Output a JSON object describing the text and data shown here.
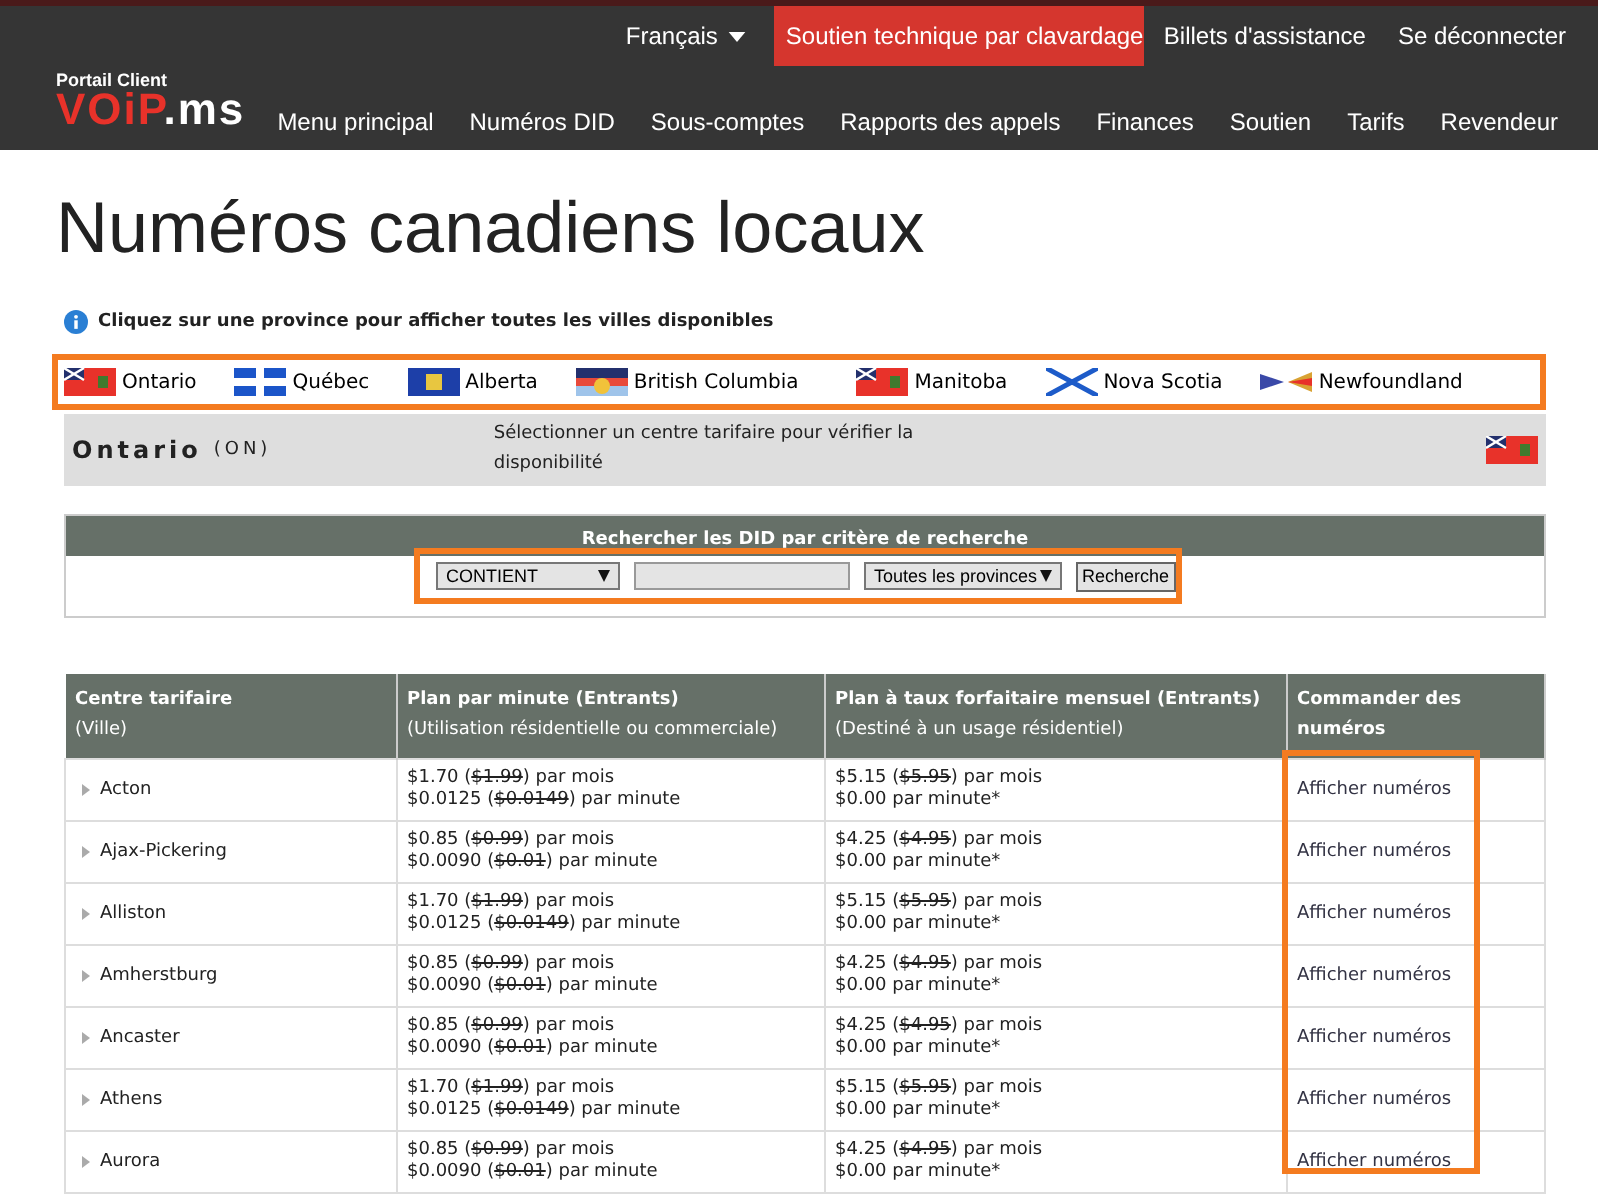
{
  "header": {
    "language": "Français",
    "chat_button": "Soutien technique par clavardage",
    "top_links": [
      "Billets d'assistance",
      "Se déconnecter"
    ],
    "logo_caption": "Portail Client",
    "logo": [
      "VOiP",
      ".ms"
    ],
    "nav": [
      "Menu principal",
      "Numéros DID",
      "Sous-comptes",
      "Rapports des appels",
      "Finances",
      "Soutien",
      "Tarifs",
      "Revendeur"
    ]
  },
  "title": "Numéros canadiens locaux",
  "info": "Cliquez sur une province pour afficher toutes les villes disponibles",
  "provinces": [
    {
      "name": "Ontario"
    },
    {
      "name": "Québec"
    },
    {
      "name": "Alberta"
    },
    {
      "name": "British Columbia"
    },
    {
      "name": "Manitoba"
    },
    {
      "name": "Nova Scotia"
    },
    {
      "name": "Newfoundland"
    }
  ],
  "province_bar": {
    "name": "Ontario",
    "code": "(ON)",
    "hint": "Sélectionner un centre tarifaire pour vérifier la disponibilité"
  },
  "search": {
    "title": "Rechercher les DID par critère de recherche",
    "criteria": "CONTIENT",
    "province": "Toutes les provinces",
    "button": "Recherche"
  },
  "table": {
    "columns": [
      {
        "title": "Centre tarifaire",
        "sub": "(Ville)"
      },
      {
        "title": "Plan par minute (Entrants)",
        "sub": "(Utilisation résidentielle ou commerciale)"
      },
      {
        "title": "Plan à taux forfaitaire mensuel (Entrants)",
        "sub": "(Destiné à un usage résidentiel)"
      },
      {
        "title": "Commander des numéros"
      }
    ],
    "rows": [
      {
        "city": "Acton",
        "per_minute": [
          {
            "pre": "$1.70 (",
            "old": "$1.99",
            "post": ") par mois"
          },
          {
            "pre": "$0.0125 (",
            "old": "$0.0149",
            "post": ") par minute"
          }
        ],
        "flat": [
          {
            "pre": "$5.15 (",
            "old": "$5.95",
            "post": ") par mois"
          },
          {
            "pre": "$0.00 par minute*"
          }
        ],
        "action": "Afficher numéros"
      },
      {
        "city": "Ajax-Pickering",
        "per_minute": [
          {
            "pre": "$0.85 (",
            "old": "$0.99",
            "post": ") par mois"
          },
          {
            "pre": "$0.0090 (",
            "old": "$0.01",
            "post": ") par minute"
          }
        ],
        "flat": [
          {
            "pre": "$4.25 (",
            "old": "$4.95",
            "post": ") par mois"
          },
          {
            "pre": "$0.00 par minute*"
          }
        ],
        "action": "Afficher numéros"
      },
      {
        "city": "Alliston",
        "per_minute": [
          {
            "pre": "$1.70 (",
            "old": "$1.99",
            "post": ") par mois"
          },
          {
            "pre": "$0.0125 (",
            "old": "$0.0149",
            "post": ") par minute"
          }
        ],
        "flat": [
          {
            "pre": "$5.15 (",
            "old": "$5.95",
            "post": ") par mois"
          },
          {
            "pre": "$0.00 par minute*"
          }
        ],
        "action": "Afficher numéros"
      },
      {
        "city": "Amherstburg",
        "per_minute": [
          {
            "pre": "$0.85 (",
            "old": "$0.99",
            "post": ") par mois"
          },
          {
            "pre": "$0.0090 (",
            "old": "$0.01",
            "post": ") par minute"
          }
        ],
        "flat": [
          {
            "pre": "$4.25 (",
            "old": "$4.95",
            "post": ") par mois"
          },
          {
            "pre": "$0.00 par minute*"
          }
        ],
        "action": "Afficher numéros"
      },
      {
        "city": "Ancaster",
        "per_minute": [
          {
            "pre": "$0.85 (",
            "old": "$0.99",
            "post": ") par mois"
          },
          {
            "pre": "$0.0090 (",
            "old": "$0.01",
            "post": ") par minute"
          }
        ],
        "flat": [
          {
            "pre": "$4.25 (",
            "old": "$4.95",
            "post": ") par mois"
          },
          {
            "pre": "$0.00 par minute*"
          }
        ],
        "action": "Afficher numéros"
      },
      {
        "city": "Athens",
        "per_minute": [
          {
            "pre": "$1.70 (",
            "old": "$1.99",
            "post": ") par mois"
          },
          {
            "pre": "$0.0125 (",
            "old": "$0.0149",
            "post": ") par minute"
          }
        ],
        "flat": [
          {
            "pre": "$5.15 (",
            "old": "$5.95",
            "post": ") par mois"
          },
          {
            "pre": "$0.00 par minute*"
          }
        ],
        "action": "Afficher numéros"
      },
      {
        "city": "Aurora",
        "per_minute": [
          {
            "pre": "$0.85 (",
            "old": "$0.99",
            "post": ") par mois"
          },
          {
            "pre": "$0.0090 (",
            "old": "$0.01",
            "post": ") par minute"
          }
        ],
        "flat": [
          {
            "pre": "$4.25 (",
            "old": "$4.95",
            "post": ") par mois"
          },
          {
            "pre": "$0.00 par minute*"
          }
        ],
        "action": "Afficher numéros"
      }
    ]
  }
}
